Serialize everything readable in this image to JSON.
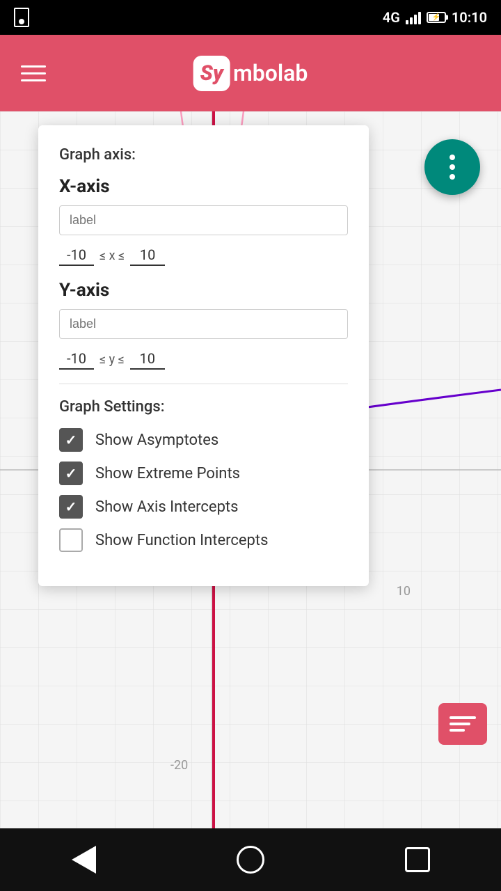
{
  "statusBar": {
    "signal": "4G",
    "time": "10:10"
  },
  "header": {
    "logoSy": "Sy",
    "logoRest": "mbolab",
    "menuLabel": "Menu"
  },
  "modal": {
    "graphAxisLabel": "Graph axis:",
    "xAxisLabel": "X-axis",
    "xInputPlaceholder": "label",
    "xMin": "-10",
    "xLte1": "≤ x ≤",
    "xMax": "10",
    "yAxisLabel": "Y-axis",
    "yInputPlaceholder": "label",
    "yMin": "-10",
    "yLte1": "≤ y ≤",
    "yMax": "10",
    "graphSettingsLabel": "Graph Settings:",
    "checkboxes": [
      {
        "id": "asymptotes",
        "label": "Show Asymptotes",
        "checked": true
      },
      {
        "id": "extremePoints",
        "label": "Show Extreme Points",
        "checked": true
      },
      {
        "id": "axisIntercepts",
        "label": "Show Axis Intercepts",
        "checked": true
      },
      {
        "id": "functionIntercepts",
        "label": "Show Function Intercepts",
        "checked": false
      }
    ]
  },
  "graph": {
    "label10": "10",
    "labelMinus20": "-20"
  },
  "fab": {
    "label": "More options"
  },
  "nav": {
    "backLabel": "Back",
    "homeLabel": "Home",
    "recentLabel": "Recent"
  }
}
